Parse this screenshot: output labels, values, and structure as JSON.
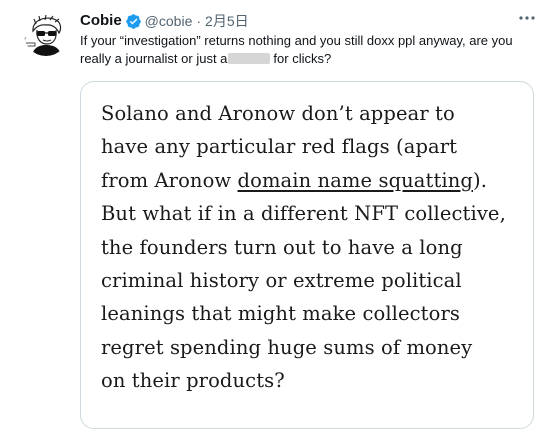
{
  "tweet": {
    "author": {
      "display_name": "Cobie",
      "handle": "@cobie",
      "verified": true,
      "avatar_icon": "cartoon-avatar-icon"
    },
    "separator": "·",
    "date": "2月5日",
    "more_icon": "more-dots-icon",
    "text": {
      "line1": "If your “investigation” returns nothing and you still doxx ppl anyway, are you",
      "line2_before": "really a journalist or just a",
      "line2_after": "for clicks?"
    },
    "media": {
      "lines": [
        "Solano and Aronow don’t appear to",
        "have any particular red flags (apart",
        "from Aronow ",
        "domain name squatting",
        ").",
        "But what if in a different NFT collective,",
        "the founders turn out to have a long",
        "criminal history or extreme political",
        "leanings that might make collectors",
        "regret spending huge sums of money",
        "on their products?"
      ]
    }
  },
  "colors": {
    "text": "#0f1419",
    "secondary": "#536471",
    "verified_blue": "#1d9bf0",
    "border": "#cfd9de",
    "redaction": "#d6d6d6"
  }
}
